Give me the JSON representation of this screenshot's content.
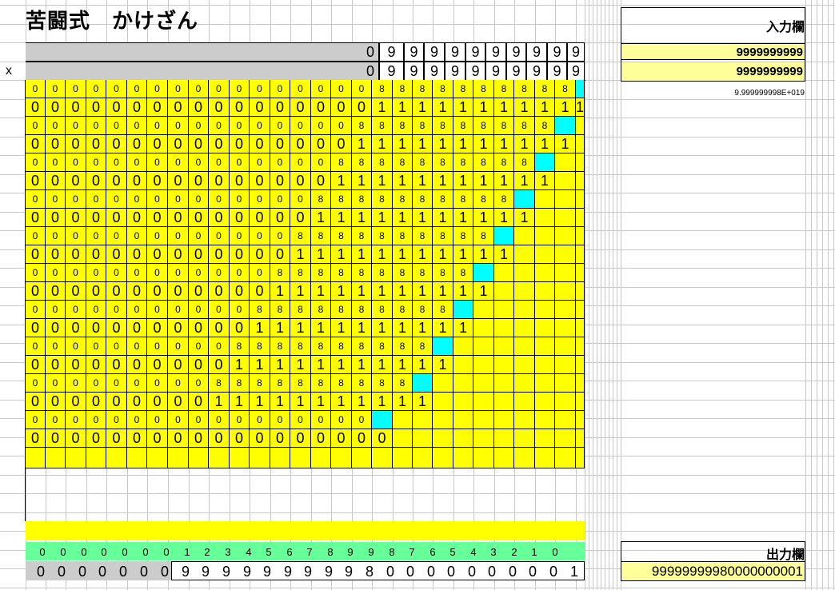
{
  "app": {
    "title": "苦闘式　かけざん"
  },
  "multiply_sign": "x",
  "operands": {
    "a_digits": [
      "0",
      "9",
      "9",
      "9",
      "9",
      "9",
      "9",
      "9",
      "9",
      "9",
      "9"
    ],
    "b_digits": [
      "0",
      "9",
      "9",
      "9",
      "9",
      "9",
      "9",
      "9",
      "9",
      "9",
      "9"
    ]
  },
  "input_panel": {
    "label": "入力欄",
    "value_a": "9999999999",
    "value_b": "9999999999",
    "float_note": "9.999999998E+019"
  },
  "carry_row": [
    "0",
    "0",
    "0",
    "0",
    "0",
    "0",
    "0",
    "1",
    "2",
    "3",
    "4",
    "5",
    "6",
    "7",
    "8",
    "9",
    "9",
    "8",
    "7",
    "6",
    "5",
    "4",
    "3",
    "2",
    "1",
    "0"
  ],
  "result_row": [
    "0",
    "0",
    "0",
    "0",
    "0",
    "0",
    "0",
    "9",
    "9",
    "9",
    "9",
    "9",
    "9",
    "9",
    "9",
    "9",
    "8",
    "0",
    "0",
    "0",
    "0",
    "0",
    "0",
    "0",
    "0",
    "0",
    "1"
  ],
  "output_panel": {
    "label": "出力欄",
    "value": "99999999980000000001"
  },
  "colors": {
    "grid_fill": "#ffff00",
    "highlight": "#00ffff",
    "carry_fill": "#66ff99",
    "operand_fill": "#cccccc",
    "panel_fill": "#ffff99"
  }
}
